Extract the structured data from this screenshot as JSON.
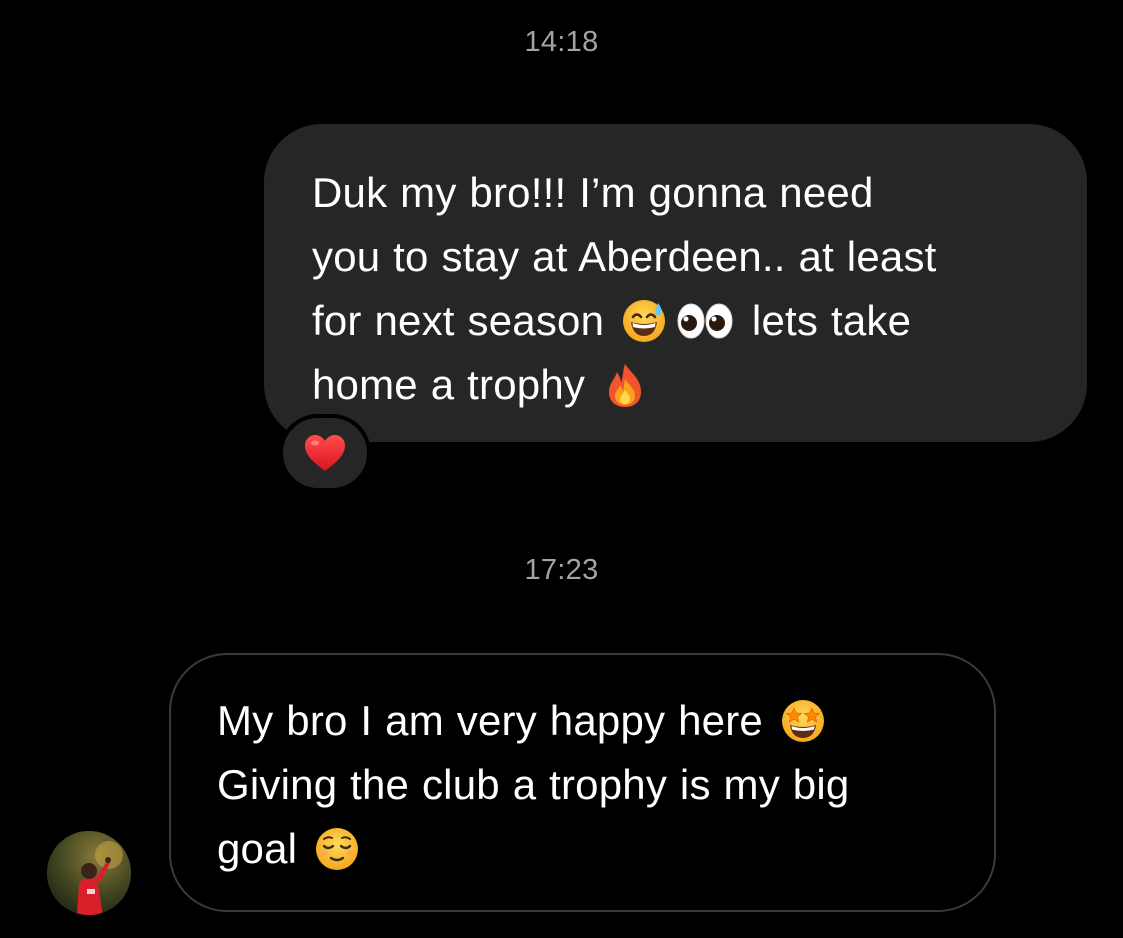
{
  "conversation": {
    "timestamps": [
      "14:18",
      "17:23"
    ],
    "outgoing": {
      "lines": [
        "Duk my bro!!! I’m gonna need",
        "you to stay at Aberdeen.. at least",
        "for next season",
        "lets take",
        "home a trophy"
      ],
      "emojis": [
        "grinning-sweat-emoji",
        "eyes-emoji",
        "fire-emoji"
      ],
      "reaction": "red-heart-emoji"
    },
    "incoming": {
      "lines": [
        "My bro I am very happy here",
        "Giving the club a trophy is my big",
        "goal"
      ],
      "emojis": [
        "star-struck-emoji",
        "relieved-face-emoji"
      ],
      "sender_avatar": "contact-avatar"
    }
  },
  "colors": {
    "background": "#000000",
    "outgoing_bubble": "#262626",
    "incoming_border": "#3a3a3a",
    "timestamp": "#a3a3a3",
    "text": "#ffffff"
  }
}
